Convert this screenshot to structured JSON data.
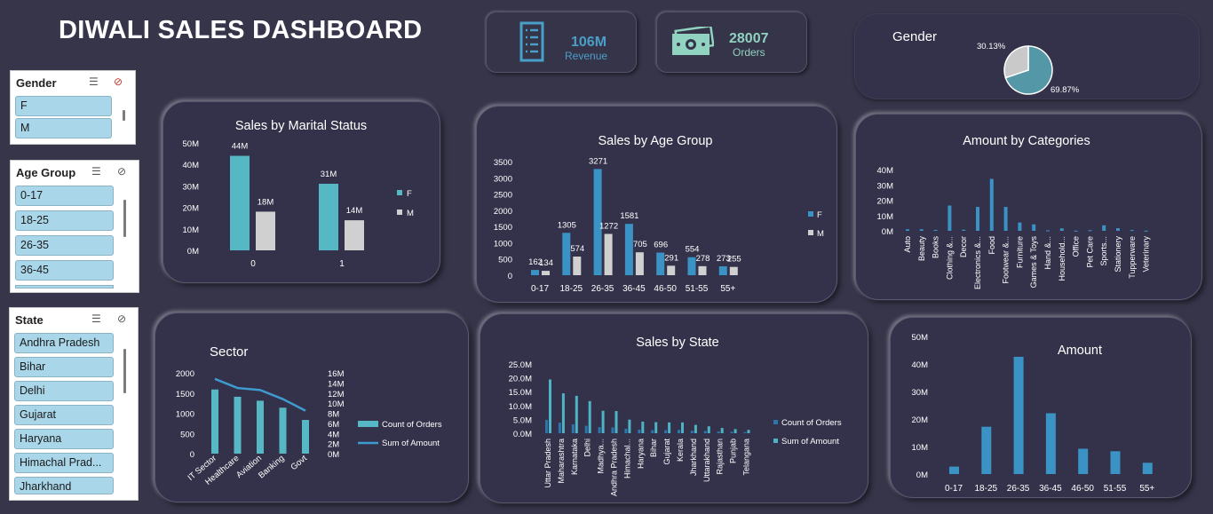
{
  "header": {
    "title": "DIWALI SALES DASHBOARD"
  },
  "kpis": {
    "revenue": {
      "value": "106M",
      "label": "Revenue",
      "icon": "invoice-icon",
      "color": "#4a9fc9"
    },
    "orders": {
      "value": "28007",
      "label": "Orders",
      "icon": "money-icon",
      "color": "#8fd3c0"
    }
  },
  "slicers": {
    "gender": {
      "title": "Gender",
      "items": [
        "F",
        "M"
      ]
    },
    "age": {
      "title": "Age Group",
      "items": [
        "0-17",
        "18-25",
        "26-35",
        "36-45"
      ]
    },
    "state": {
      "title": "State",
      "items": [
        "Andhra Pradesh",
        "Bihar",
        "Delhi",
        "Gujarat",
        "Haryana",
        "Himachal Prad...",
        "Jharkhand"
      ]
    }
  },
  "colors": {
    "teal": "#56b8c4",
    "grey": "#d0d0d0",
    "blue": "#3a93c4",
    "line": "#3f9ad0",
    "bg": "#37354a",
    "text": "#ffffff"
  },
  "chart_data": [
    {
      "id": "gender",
      "type": "pie",
      "title": "Gender",
      "categories": [
        "F",
        "M"
      ],
      "values": [
        69.87,
        30.13
      ],
      "labels": [
        "69.87%",
        "30.13%"
      ]
    },
    {
      "id": "marital",
      "type": "bar",
      "title": "Sales by Marital Status",
      "categories": [
        "0",
        "1"
      ],
      "series": [
        {
          "name": "F",
          "values": [
            44,
            31
          ],
          "labels": [
            "44M",
            "31M"
          ]
        },
        {
          "name": "M",
          "values": [
            18,
            14
          ],
          "labels": [
            "18M",
            "14M"
          ]
        }
      ],
      "ylim": [
        0,
        50
      ],
      "yticks": [
        "0M",
        "10M",
        "20M",
        "30M",
        "40M",
        "50M"
      ]
    },
    {
      "id": "age",
      "type": "bar",
      "title": "Sales by Age Group",
      "categories": [
        "0-17",
        "18-25",
        "26-35",
        "36-45",
        "46-50",
        "51-55",
        "55+"
      ],
      "series": [
        {
          "name": "F",
          "values": [
            162,
            1305,
            3271,
            1581,
            696,
            554,
            273
          ]
        },
        {
          "name": "M",
          "values": [
            134,
            574,
            1272,
            705,
            291,
            278,
            255
          ]
        }
      ],
      "ylim": [
        0,
        3500
      ],
      "yticks": [
        "0",
        "500",
        "1000",
        "1500",
        "2000",
        "2500",
        "3000",
        "3500"
      ]
    },
    {
      "id": "categories",
      "type": "bar",
      "title": "Amount by Categories",
      "categories": [
        "Auto",
        "Beauty",
        "Books",
        "Clothing &...",
        "Decor",
        "Electronics &...",
        "Food",
        "Footwear &...",
        "Furniture",
        "Games & Toys",
        "Hand &...",
        "Household...",
        "Office",
        "Pet Care",
        "Sports...",
        "Stationery",
        "Tupperware",
        "Veterinary"
      ],
      "values": [
        1.0,
        1.0,
        0.6,
        16.5,
        0.7,
        15.6,
        33.9,
        15.6,
        5.4,
        4.2,
        0.3,
        1.6,
        0.1,
        0.4,
        3.6,
        1.7,
        0.5,
        0.1
      ],
      "ylim": [
        0,
        40
      ],
      "yticks": [
        "0M",
        "10M",
        "20M",
        "30M",
        "40M"
      ]
    },
    {
      "id": "sector",
      "type": "bar",
      "title": "Sector",
      "categories": [
        "IT Sector",
        "Healthcare",
        "Aviation",
        "Banking",
        "Govt"
      ],
      "series": [
        {
          "name": "Count of Orders",
          "values": [
            1588,
            1408,
            1310,
            1137,
            835
          ]
        },
        {
          "name": "Sum of Amount",
          "values": [
            14.8,
            13.0,
            12.6,
            10.8,
            8.5
          ]
        }
      ],
      "ylim": [
        0,
        2000
      ],
      "y2lim": [
        0,
        16
      ],
      "yticks": [
        "0",
        "500",
        "1000",
        "1500",
        "2000"
      ],
      "y2ticks": [
        "0M",
        "2M",
        "4M",
        "6M",
        "8M",
        "10M",
        "12M",
        "14M",
        "16M"
      ]
    },
    {
      "id": "state",
      "type": "bar",
      "title": "Sales by State",
      "categories": [
        "Uttar Pradesh",
        "Maharashtra",
        "Karnataka",
        "Delhi",
        "Madhya...",
        "Andhra Pradesh",
        "Himachal...",
        "Haryana",
        "Bihar",
        "Gujarat",
        "Kerala",
        "Jharkhand",
        "Uttarakhand",
        "Rajasthan",
        "Punjab",
        "Telangana"
      ],
      "series": [
        {
          "name": "Count of Orders",
          "values": [
            4.8,
            3.8,
            3.2,
            2.7,
            2.2,
            2.1,
            1.6,
            1.3,
            1.1,
            1.1,
            1.2,
            0.9,
            0.8,
            0.6,
            0.5,
            0.4
          ]
        },
        {
          "name": "Sum of Amount",
          "values": [
            19.4,
            14.4,
            13.5,
            11.6,
            8.1,
            8.0,
            4.9,
            4.2,
            4.0,
            3.9,
            3.9,
            3.0,
            2.5,
            1.9,
            1.5,
            1.2
          ]
        }
      ],
      "ylim": [
        0,
        25
      ],
      "yticks": [
        "0.0M",
        "5.0M",
        "10.0M",
        "15.0M",
        "20.0M",
        "25.0M"
      ]
    },
    {
      "id": "amount",
      "type": "bar",
      "title": "Amount",
      "categories": [
        "0-17",
        "18-25",
        "26-35",
        "36-45",
        "46-50",
        "51-55",
        "55+"
      ],
      "values": [
        2.7,
        17.2,
        42.6,
        22.1,
        9.2,
        8.3,
        4.1
      ],
      "ylim": [
        0,
        50
      ],
      "yticks": [
        "0M",
        "10M",
        "20M",
        "30M",
        "40M",
        "50M"
      ]
    }
  ]
}
